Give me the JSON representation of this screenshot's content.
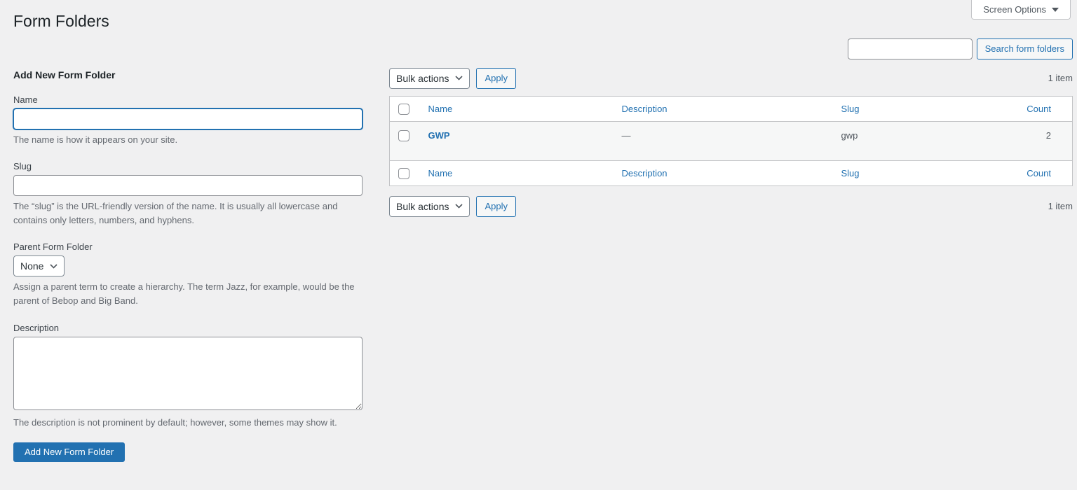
{
  "page": {
    "title": "Form Folders"
  },
  "screen_options": {
    "label": "Screen Options"
  },
  "search": {
    "input_value": "",
    "button_label": "Search form folders"
  },
  "tablenav": {
    "bulk_actions_label": "Bulk actions",
    "apply_label": "Apply",
    "item_count_top": "1 item",
    "item_count_bottom": "1 item"
  },
  "form": {
    "heading": "Add New Form Folder",
    "name": {
      "label": "Name",
      "value": "",
      "help": "The name is how it appears on your site."
    },
    "slug": {
      "label": "Slug",
      "value": "",
      "help": "The “slug” is the URL-friendly version of the name. It is usually all lowercase and contains only letters, numbers, and hyphens."
    },
    "parent": {
      "label": "Parent Form Folder",
      "selected_option": "None",
      "help": "Assign a parent term to create a hierarchy. The term Jazz, for example, would be the parent of Bebop and Big Band."
    },
    "description": {
      "label": "Description",
      "value": "",
      "help": "The description is not prominent by default; however, some themes may show it."
    },
    "submit_label": "Add New Form Folder"
  },
  "table": {
    "columns": {
      "name": "Name",
      "description": "Description",
      "slug": "Slug",
      "count": "Count"
    },
    "rows": [
      {
        "name": "GWP",
        "description": "—",
        "slug": "gwp",
        "count": "2"
      }
    ]
  },
  "colors": {
    "accent": "#2271b1",
    "background": "#f0f0f1",
    "table_border": "#c3c4c7",
    "row_stripe": "#f6f7f7"
  }
}
